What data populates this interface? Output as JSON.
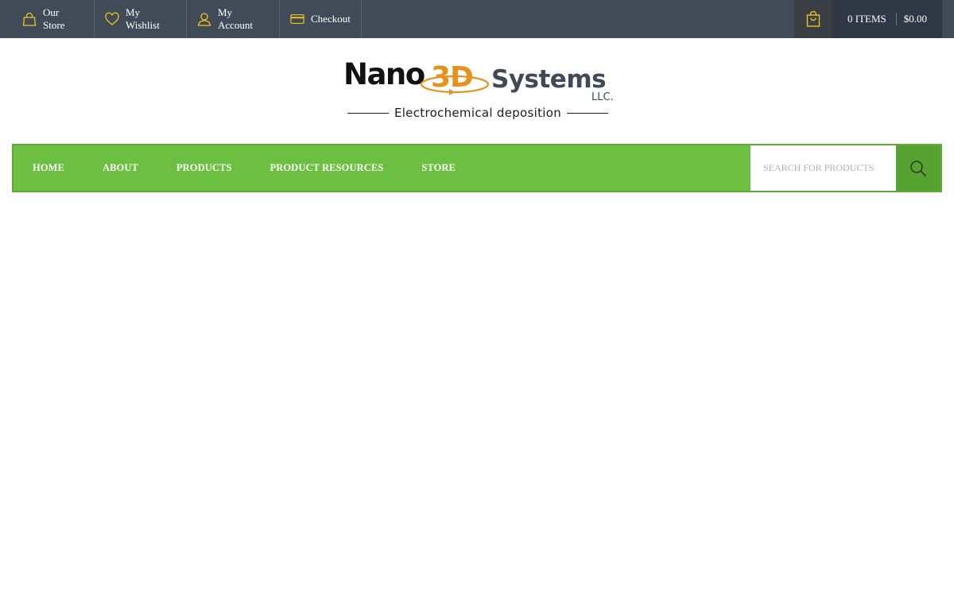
{
  "topbar": {
    "links": [
      {
        "label": "Our Store",
        "icon": "shopping-bag-icon"
      },
      {
        "label": "My Wishlist",
        "icon": "heart-icon"
      },
      {
        "label": "My Account",
        "icon": "user-icon"
      },
      {
        "label": "Checkout",
        "icon": "credit-card-icon"
      }
    ],
    "cart": {
      "items": "0 ITEMS",
      "total": "$0.00",
      "icon": "cart-bag-icon"
    }
  },
  "logo": {
    "word_nano": "Nano",
    "word_3d": "3D",
    "word_systems": "Systems",
    "suffix": "LLC.",
    "tagline": "Electrochemical deposition"
  },
  "nav": {
    "items": [
      {
        "label": "HOME"
      },
      {
        "label": "ABOUT"
      },
      {
        "label": "PRODUCTS"
      },
      {
        "label": "PRODUCT RESOURCES"
      },
      {
        "label": "STORE"
      }
    ],
    "search": {
      "placeholder": "SEARCH FOR PRODUCTS",
      "value": "",
      "icon": "search-icon"
    }
  },
  "colors": {
    "topbar": "#414b58",
    "accent_yellow": "#f2c21b",
    "nav_green": "#6cbf40",
    "search_btn_green": "#57a332",
    "logo_orange": "#e8921c",
    "logo_gray": "#3f4957"
  }
}
